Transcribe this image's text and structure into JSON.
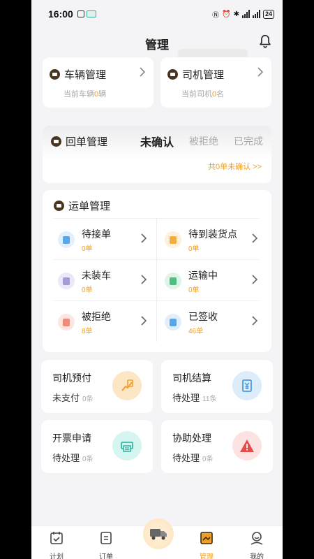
{
  "status_bar": {
    "time": "16:00",
    "battery": "24"
  },
  "header": {
    "title": "管理"
  },
  "vehicle_card": {
    "title": "车辆管理",
    "sub_prefix": "当前车辆",
    "count": "0",
    "sub_suffix": "辆"
  },
  "driver_card": {
    "title": "司机管理",
    "sub_prefix": "当前司机",
    "count": "0",
    "sub_suffix": "名"
  },
  "receipt": {
    "title": "回单管理",
    "tabs": [
      "未确认",
      "被拒绝",
      "已完成"
    ],
    "active_tab": "未确认",
    "link": "共0单未确认 >>"
  },
  "waybill": {
    "title": "运单管理",
    "items": [
      {
        "label": "待接单",
        "count": "0单",
        "color": "#e3f0fb",
        "icon_color": "#5aa6e6"
      },
      {
        "label": "待到装货点",
        "count": "0单",
        "color": "#fdf0dc",
        "icon_color": "#f0b040"
      },
      {
        "label": "未装车",
        "count": "0单",
        "color": "#ebe8f7",
        "icon_color": "#a89ad8"
      },
      {
        "label": "运输中",
        "count": "0单",
        "color": "#def4e7",
        "icon_color": "#4cc07e"
      },
      {
        "label": "被拒绝",
        "count": "8单",
        "color": "#fde6e2",
        "icon_color": "#f08a7a"
      },
      {
        "label": "已签收",
        "count": "46单",
        "color": "#e2effb",
        "icon_color": "#5aa6e6"
      }
    ]
  },
  "tiles": [
    {
      "title": "司机预付",
      "status": "未支付",
      "count": "0条",
      "bg": "#fde6c4",
      "fg": "#f0a030"
    },
    {
      "title": "司机结算",
      "status": "待处理",
      "count": "11条",
      "bg": "#dcecf9",
      "fg": "#4a9ae0"
    },
    {
      "title": "开票申请",
      "status": "待处理",
      "count": "0条",
      "bg": "#d6f5f0",
      "fg": "#36b8a4"
    },
    {
      "title": "协助处理",
      "status": "待处理",
      "count": "0条",
      "bg": "#fde2e2",
      "fg": "#e84a4a"
    }
  ],
  "tabbar": {
    "items": [
      {
        "label": "计划"
      },
      {
        "label": "订单"
      },
      {
        "label": "管理"
      },
      {
        "label": "我的"
      }
    ],
    "active": "管理"
  },
  "colors": {
    "accent": "#f0a020"
  }
}
